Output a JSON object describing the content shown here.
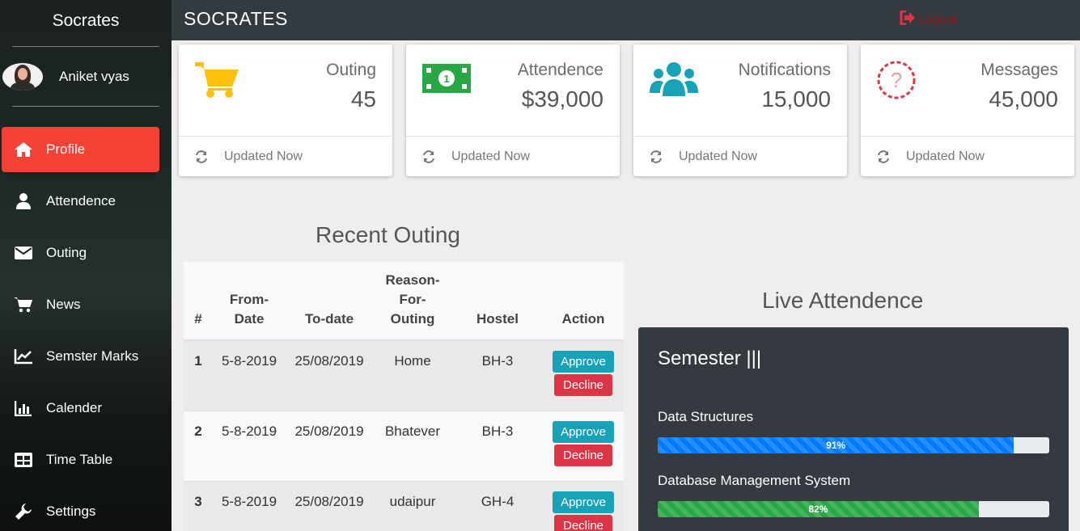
{
  "sidebar": {
    "brand": "Socrates",
    "user_name": "Aniket vyas",
    "items": [
      {
        "label": "Profile",
        "icon": "home-icon"
      },
      {
        "label": "Attendence",
        "icon": "user-icon"
      },
      {
        "label": "Outing",
        "icon": "envelope-icon"
      },
      {
        "label": "News",
        "icon": "cart-icon"
      },
      {
        "label": "Semster Marks",
        "icon": "chart-line-icon"
      },
      {
        "label": "Calender",
        "icon": "bar-chart-icon"
      },
      {
        "label": "Time Table",
        "icon": "table-icon"
      },
      {
        "label": "Settings",
        "icon": "wrench-icon"
      }
    ]
  },
  "header": {
    "title": "SOCRATES",
    "logout": "Logout"
  },
  "cards": [
    {
      "label": "Outing",
      "value": "45",
      "footer": "Updated Now",
      "icon": "cart-icon",
      "color": "#ffc107"
    },
    {
      "label": "Attendence",
      "value": "$39,000",
      "footer": "Updated Now",
      "icon": "money-icon",
      "color": "#28a745"
    },
    {
      "label": "Notifications",
      "value": "15,000",
      "footer": "Updated Now",
      "icon": "users-icon",
      "color": "#17a2b8"
    },
    {
      "label": "Messages",
      "value": "45,000",
      "footer": "Updated Now",
      "icon": "question-icon",
      "color": "#dc3545"
    }
  ],
  "recent_outing": {
    "title": "Recent Outing",
    "columns": [
      "#",
      "From-\nDate",
      "To-date",
      "Reason-\nFor-\nOuting",
      "Hostel",
      "Action"
    ],
    "rows": [
      {
        "num": "1",
        "from": "5-8-2019",
        "to": "25/08/2019",
        "reason": "Home",
        "hostel": "BH-3"
      },
      {
        "num": "2",
        "from": "5-8-2019",
        "to": "25/08/2019",
        "reason": "Bhatever",
        "hostel": "BH-3"
      },
      {
        "num": "3",
        "from": "5-8-2019",
        "to": "25/08/2019",
        "reason": "udaipur",
        "hostel": "GH-4"
      }
    ],
    "approve_label": "Approve",
    "decline_label": "Decline"
  },
  "live": {
    "title": "Live Attendence",
    "semester": "Semester |||",
    "subjects": [
      {
        "name": "Data Structures",
        "percent": 91,
        "label": "91%",
        "color": "#007bff"
      },
      {
        "name": "Database Management System",
        "percent": 82,
        "label": "82%",
        "color": "#28a745"
      }
    ]
  }
}
